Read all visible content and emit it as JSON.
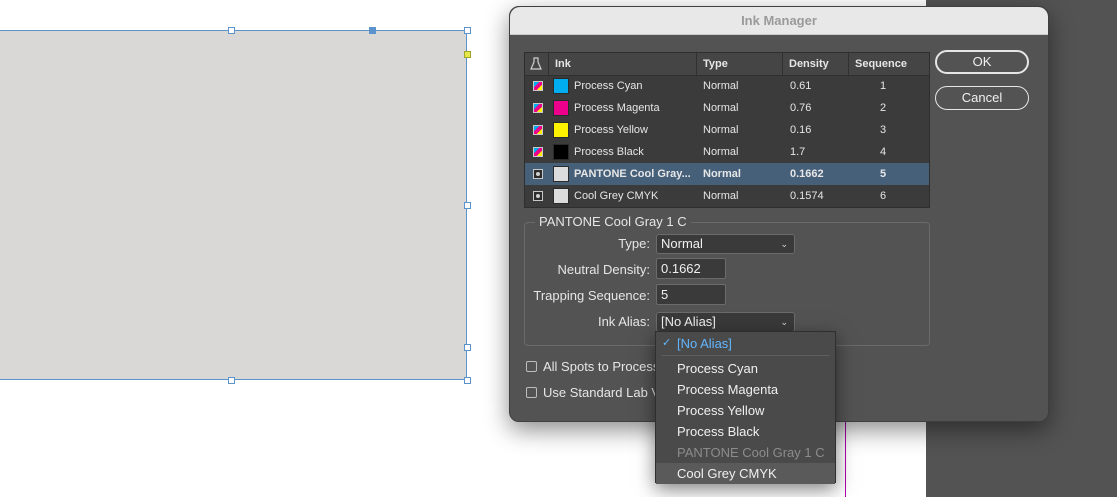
{
  "dialog": {
    "title": "Ink Manager",
    "ok_label": "OK",
    "cancel_label": "Cancel"
  },
  "table": {
    "headers": {
      "ink": "Ink",
      "type": "Type",
      "density": "Density",
      "sequence": "Sequence"
    },
    "rows": [
      {
        "kind": "process",
        "swatch": "#00aeef",
        "ink": "Process Cyan",
        "type": "Normal",
        "density": "0.61",
        "sequence": "1"
      },
      {
        "kind": "process",
        "swatch": "#ec008c",
        "ink": "Process Magenta",
        "type": "Normal",
        "density": "0.76",
        "sequence": "2"
      },
      {
        "kind": "process",
        "swatch": "#fff200",
        "ink": "Process Yellow",
        "type": "Normal",
        "density": "0.16",
        "sequence": "3"
      },
      {
        "kind": "process",
        "swatch": "#000000",
        "ink": "Process Black",
        "type": "Normal",
        "density": "1.7",
        "sequence": "4"
      },
      {
        "kind": "spot",
        "swatch": "#dcdcdc",
        "ink": "PANTONE Cool Gray...",
        "type": "Normal",
        "density": "0.1662",
        "sequence": "5",
        "selected": true
      },
      {
        "kind": "spot",
        "swatch": "#dcdcdc",
        "ink": "Cool Grey CMYK",
        "type": "Normal",
        "density": "0.1574",
        "sequence": "6"
      }
    ]
  },
  "details": {
    "group_title": "PANTONE Cool Gray 1 C",
    "type_label": "Type:",
    "type_value": "Normal",
    "neutral_density_label": "Neutral Density:",
    "neutral_density_value": "0.1662",
    "trapping_sequence_label": "Trapping Sequence:",
    "trapping_sequence_value": "5",
    "ink_alias_label": "Ink Alias:",
    "ink_alias_value": "[No Alias]"
  },
  "options": {
    "all_spots_to_process": "All Spots to Process",
    "use_standard_lab": "Use Standard Lab V"
  },
  "alias_menu": {
    "items": [
      {
        "label": "[No Alias]",
        "state": "checked"
      },
      {
        "label": "Process Cyan",
        "state": "normal"
      },
      {
        "label": "Process Magenta",
        "state": "normal"
      },
      {
        "label": "Process Yellow",
        "state": "normal"
      },
      {
        "label": "Process Black",
        "state": "normal"
      },
      {
        "label": "PANTONE Cool Gray 1 C",
        "state": "disabled"
      },
      {
        "label": "Cool Grey CMYK",
        "state": "hover"
      }
    ]
  },
  "colors": {
    "selection_blue": "#5b93cc",
    "selected_row": "#47607a",
    "checked_item": "#62b6ff",
    "dialog_bg": "#535353"
  }
}
